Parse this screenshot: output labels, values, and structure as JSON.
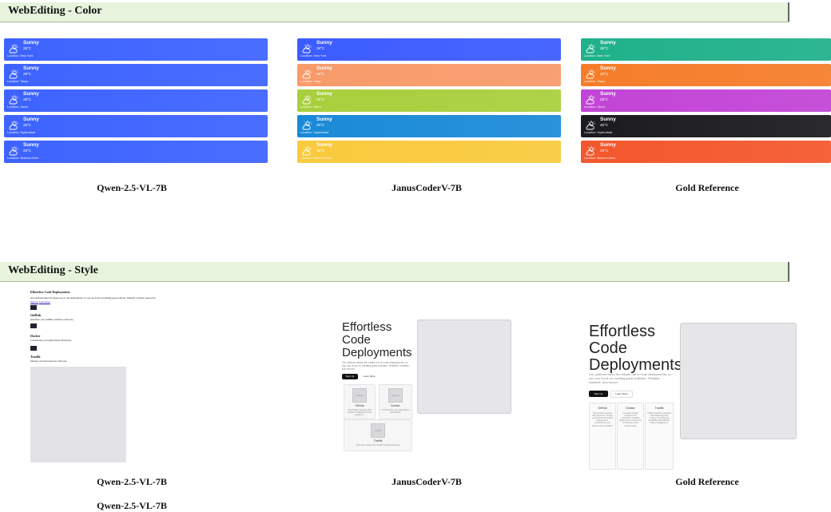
{
  "sections": {
    "color": {
      "title": "WebEditing - Color"
    },
    "style": {
      "title": "WebEditing - Style"
    }
  },
  "columns": [
    "Qwen-2.5-VL-7B",
    "JanusCoderV-7B",
    "Gold Reference"
  ],
  "weather": {
    "condition": "Sunny",
    "temp": "28°C",
    "locations": [
      "Location: New York",
      "Location: Tokyo",
      "Location: Seoul",
      "Location: Hyderabad",
      "Location: Buenos Aires"
    ],
    "qwen_colors": [
      "#3d63ff",
      "#3d63ff",
      "#3d63ff",
      "#3d63ff",
      "#3d63ff"
    ],
    "janus_colors": [
      "#3b5cff",
      "#f89a6a",
      "#a8cf3c",
      "#1a8ad8",
      "#f9ca3c"
    ],
    "gold_colors": [
      "#1fb18a",
      "#f57d2a",
      "#c244d6",
      "#1b1b1f",
      "#f4572d"
    ]
  },
  "style_demo": {
    "title_small": "Effortless Code Deployments",
    "title_lines": [
      "Effortless",
      "Code",
      "Deployments"
    ],
    "desc": "Our platform takes the hassle out of code deployments, so you can focus on building great software. Reliable, scalable, and secure.",
    "sign_up": "Sign Up",
    "learn_more": "Learn More",
    "features": [
      {
        "name": "GitHub",
        "desc": "Seamlessly integrate with GitHub for effortless CI/CD pipelines.",
        "img": "GitHub"
      },
      {
        "name": "Docker",
        "desc": "Containerize your applications with Docker.",
        "img": "Docker"
      },
      {
        "name": "Traefik",
        "desc": "Automate routing with Traefik for load balancing.",
        "img": "Traefik"
      }
    ],
    "qwen_lines": {
      "github_desc": "Automate your GitHub workflows with ease.",
      "docker_desc": "Containerize your applications effortlessly.",
      "traefik_desc": "Manage your microservices with ease."
    },
    "gold_features": [
      {
        "name": "GitHub",
        "desc": "Seamlessly integrate with GitHub for version control and automated deployments, streamlining your development workflow."
      },
      {
        "name": "Docker",
        "desc": "Leverage Docker containers for consistent, scalable deployments across any environment with minimal setup."
      },
      {
        "name": "Traefik",
        "desc": "Utilize Traefik for dynamic load balancing and routing, ensuring high availability and efficient traffic management."
      }
    ]
  }
}
